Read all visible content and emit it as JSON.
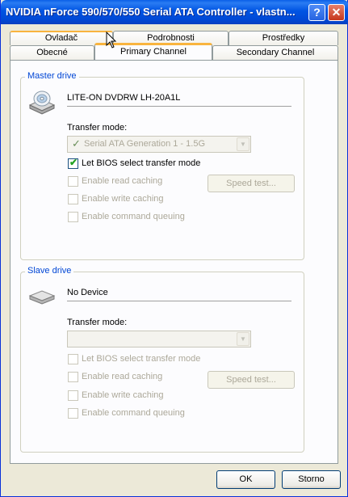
{
  "window": {
    "title": "NVIDIA nForce 590/570/550 Serial ATA Controller - vlastn...",
    "help_label": "?",
    "close_label": "✕"
  },
  "tabs_row1": [
    {
      "label": "Ovladač"
    },
    {
      "label": "Podrobnosti"
    },
    {
      "label": "Prostředky"
    }
  ],
  "tabs_row2": [
    {
      "label": "Obecné"
    },
    {
      "label": "Primary Channel",
      "active": true
    },
    {
      "label": "Secondary Channel"
    }
  ],
  "master": {
    "group_label": "Master drive",
    "device_icon": "cd-drive-icon",
    "device_name": "LITE-ON DVDRW LH-20A1L",
    "transfer_label": "Transfer mode:",
    "transfer_value": "Serial ATA Generation 1 - 1.5G",
    "bios_label": "Let BIOS select transfer mode",
    "bios_checked": true,
    "read_cache_label": "Enable read caching",
    "write_cache_label": "Enable write caching",
    "queue_label": "Enable command queuing",
    "speed_test_label": "Speed test..."
  },
  "slave": {
    "group_label": "Slave drive",
    "device_icon": "empty-drive-icon",
    "device_name": "No Device",
    "transfer_label": "Transfer mode:",
    "transfer_value": "",
    "bios_label": "Let BIOS select transfer mode",
    "read_cache_label": "Enable read caching",
    "write_cache_label": "Enable write caching",
    "queue_label": "Enable command queuing",
    "speed_test_label": "Speed test..."
  },
  "footer": {
    "ok_label": "OK",
    "cancel_label": "Storno"
  }
}
